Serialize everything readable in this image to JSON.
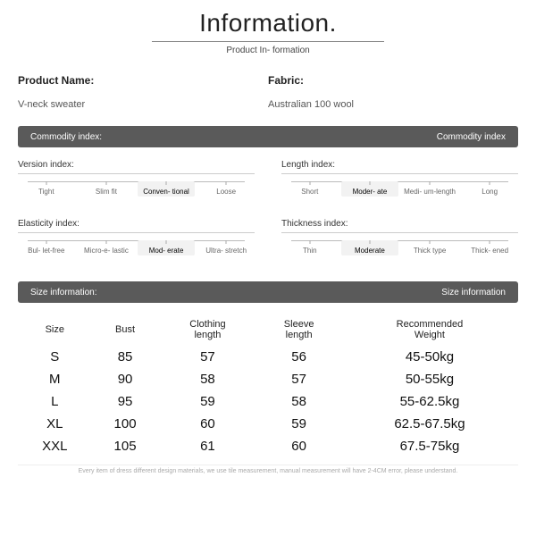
{
  "header": {
    "title": "Information.",
    "subtitle": "Product In-\nformation"
  },
  "product": {
    "name_label": "Product Name:",
    "name_value": "V-neck sweater",
    "fabric_label": "Fabric:",
    "fabric_value": "Australian 100 wool"
  },
  "commodity_bar": {
    "left": "Commodity index:",
    "right": "Commodity index"
  },
  "indices": {
    "version": {
      "label": "Version index:",
      "options": [
        "Tight",
        "Slim fit",
        "Conven-\ntional",
        "Loose"
      ],
      "selected": 2
    },
    "length": {
      "label": "Length index:",
      "options": [
        "Short",
        "Moder-\nate",
        "Medi-\num-length",
        "Long"
      ],
      "selected": 1
    },
    "elasticity": {
      "label": "Elasticity index:",
      "options": [
        "Bul-\nlet-free",
        "Micro-e-\nlastic",
        "Mod-\nerate",
        "Ultra-\nstretch"
      ],
      "selected": 2
    },
    "thickness": {
      "label": "Thickness index:",
      "options": [
        "Thin",
        "Moderate",
        "Thick\ntype",
        "Thick-\nened"
      ],
      "selected": 1
    }
  },
  "size_bar": {
    "left": "Size information:",
    "right": "Size information"
  },
  "size_table": {
    "headers": [
      "Size",
      "Bust",
      "Clothing\nlength",
      "Sleeve\nlength",
      "Recommended\nWeight"
    ],
    "rows": [
      [
        "S",
        "85",
        "57",
        "56",
        "45-50kg"
      ],
      [
        "M",
        "90",
        "58",
        "57",
        "50-55kg"
      ],
      [
        "L",
        "95",
        "59",
        "58",
        "55-62.5kg"
      ],
      [
        "XL",
        "100",
        "60",
        "59",
        "62.5-67.5kg"
      ],
      [
        "XXL",
        "105",
        "61",
        "60",
        "67.5-75kg"
      ]
    ]
  },
  "footnote": "Every item of dress different design materials, we use tile measurement, manual measurement will have 2-4CM error, please understand."
}
